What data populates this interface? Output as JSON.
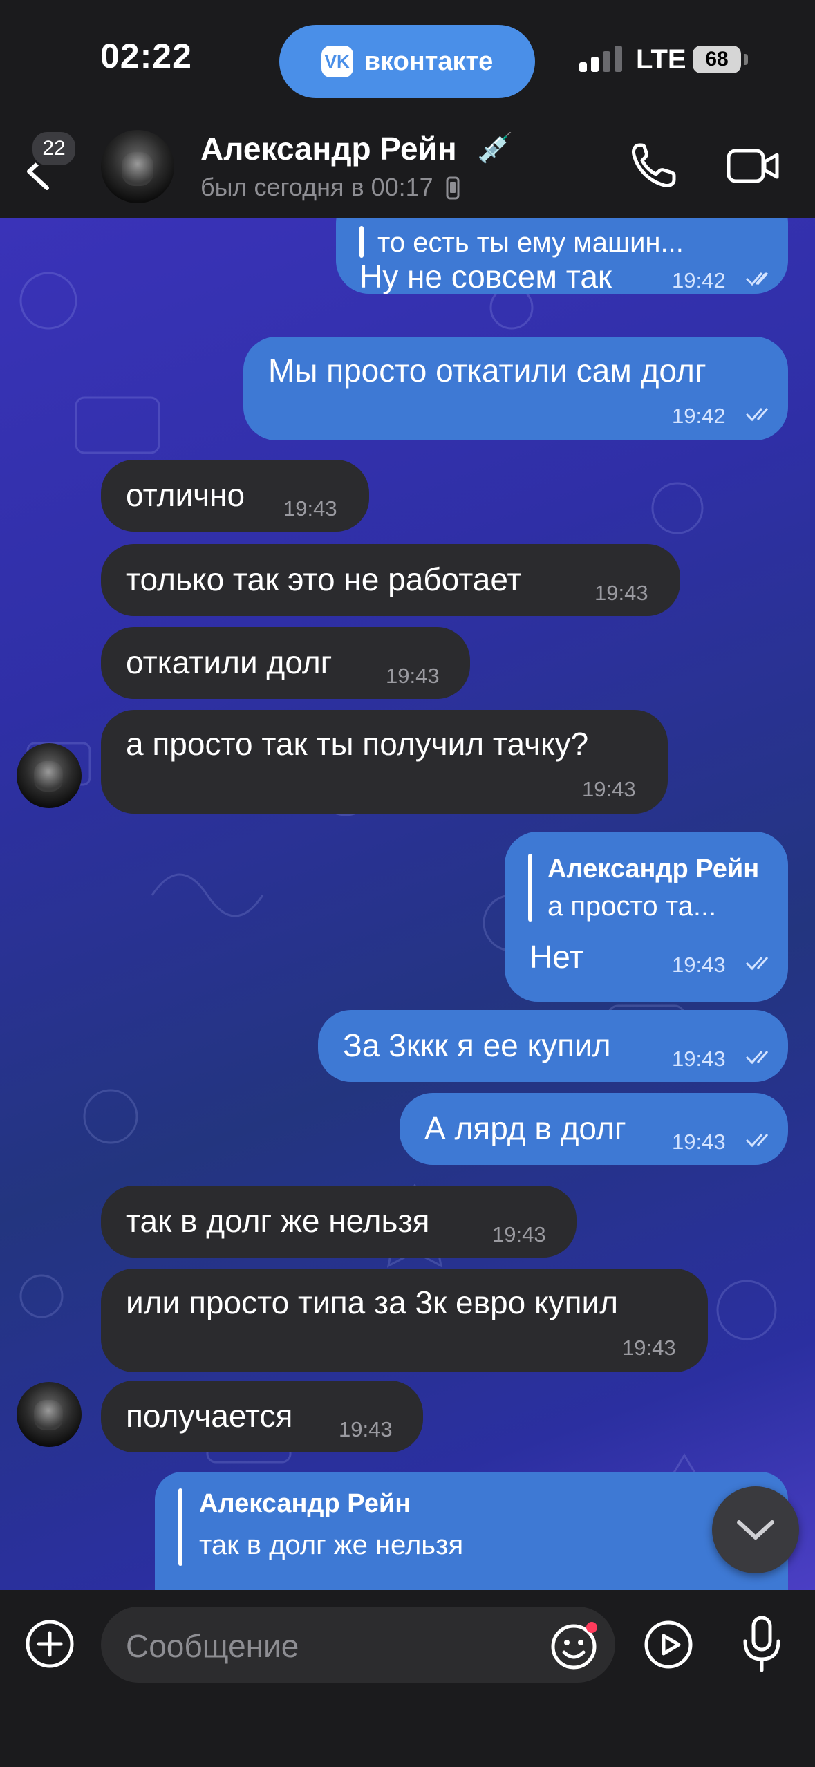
{
  "status_bar": {
    "time": "02:22",
    "app_pill_label": "вконтакте",
    "app_pill_logo": "VK",
    "network": "LTE",
    "battery": "68"
  },
  "header": {
    "back_badge": "22",
    "contact_name": "Александр Рейн",
    "contact_emoji": "💉",
    "contact_status": "был сегодня в 00:17"
  },
  "messages": [
    {
      "dir": "out",
      "reply_text": "то есть ты ему машин...",
      "text": "Ну не совсем так",
      "time": "19:42",
      "ticks": true
    },
    {
      "dir": "out",
      "text": "Мы просто откатили сам долг",
      "time": "19:42",
      "ticks": true
    },
    {
      "dir": "in",
      "text": "отлично",
      "time": "19:43"
    },
    {
      "dir": "in",
      "text": "только так это не работает",
      "time": "19:43"
    },
    {
      "dir": "in",
      "text": "откатили долг",
      "time": "19:43"
    },
    {
      "dir": "in",
      "text": "а просто так ты получил тачку?",
      "time": "19:43"
    },
    {
      "dir": "out",
      "reply_name": "Александр Рейн",
      "reply_text": "а просто та...",
      "text": "Нет",
      "time": "19:43",
      "ticks": true
    },
    {
      "dir": "out",
      "text": "За 3ккк я ее купил",
      "time": "19:43",
      "ticks": true
    },
    {
      "dir": "out",
      "text": "А лярд в долг",
      "time": "19:43",
      "ticks": true
    },
    {
      "dir": "in",
      "text": "так в долг же нельзя",
      "time": "19:43"
    },
    {
      "dir": "in",
      "text": "или просто типа за 3к евро купил",
      "time": "19:43"
    },
    {
      "dir": "in",
      "text": "получается",
      "time": "19:43"
    }
  ],
  "reply_preview": {
    "name": "Александр Рейн",
    "text": "так в долг же нельзя"
  },
  "input": {
    "placeholder": "Сообщение"
  },
  "colors": {
    "incoming_bubble": "#2b2b2e",
    "outgoing_bubble": "#3e79d4",
    "vk_blue": "#4a8fe8",
    "bars_bg": "#1b1b1d"
  },
  "icons": [
    "back-arrow-icon",
    "phone-icon",
    "video-camera-icon",
    "plus-icon",
    "emoji-icon",
    "play-icon",
    "microphone-icon",
    "chevron-down-icon",
    "double-check-icon"
  ]
}
